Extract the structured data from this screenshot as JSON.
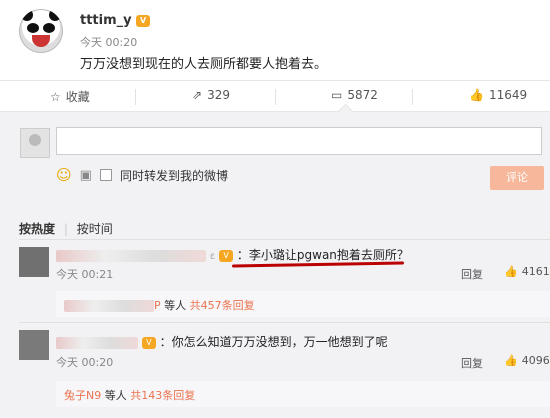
{
  "post": {
    "username": "tttim_y",
    "time": "今天 00:20",
    "text": "万万没想到现在的人去厕所都要人抱着去。"
  },
  "actions": {
    "favorite": "收藏",
    "repost": "329",
    "comment": "5872",
    "like": "11649"
  },
  "composer": {
    "repost_option": "同时转发到我的微博",
    "submit": "评论"
  },
  "sort": {
    "hot": "按热度",
    "time": "按时间"
  },
  "comments": [
    {
      "name_suffix": "ε",
      "text": "：李小璐让pgwan抱着去厕所？",
      "time": "今天 00:21",
      "reply": "回复",
      "likes": "4161",
      "sub_name": "P",
      "sub_text": "等人",
      "sub_count": "共457条回复"
    },
    {
      "name_suffix": "",
      "text": "：你怎么知道万万没想到，万一他想到了呢",
      "time": "今天 00:20",
      "reply": "回复",
      "likes": "4096",
      "sub_name": "兔子N9",
      "sub_text": "等人",
      "sub_count": "共143条回复"
    }
  ]
}
